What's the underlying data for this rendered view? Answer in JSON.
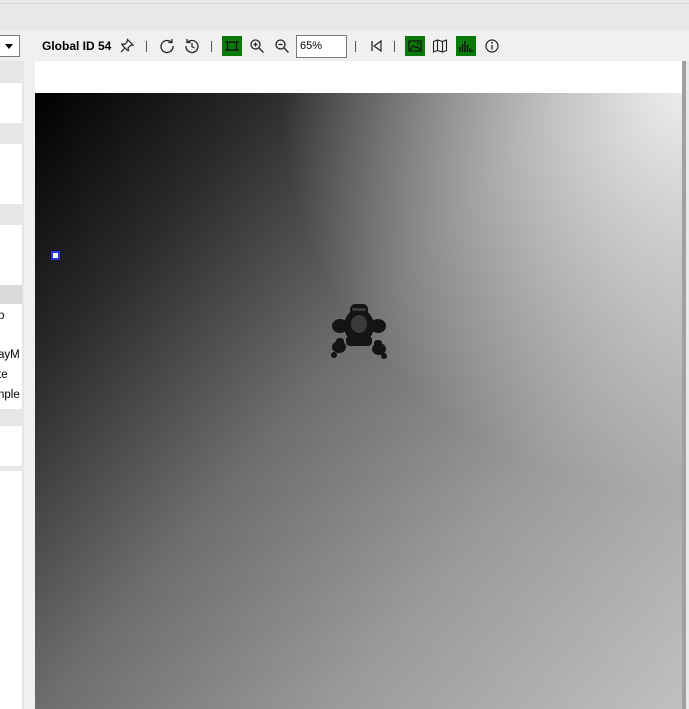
{
  "toolbar": {
    "title": "Global ID 54",
    "zoom_value": "65%",
    "icons": [
      "pin-icon",
      "refresh-icon",
      "history-icon",
      "fit-frame-icon",
      "zoom-in-icon",
      "zoom-out-icon",
      "first-frame-icon",
      "image-view-icon",
      "map-icon",
      "histogram-icon",
      "info-icon"
    ],
    "active_color": "#0a7a0a"
  },
  "left_panel": {
    "texts": [
      "p",
      "ayM",
      "te",
      "nple"
    ]
  }
}
